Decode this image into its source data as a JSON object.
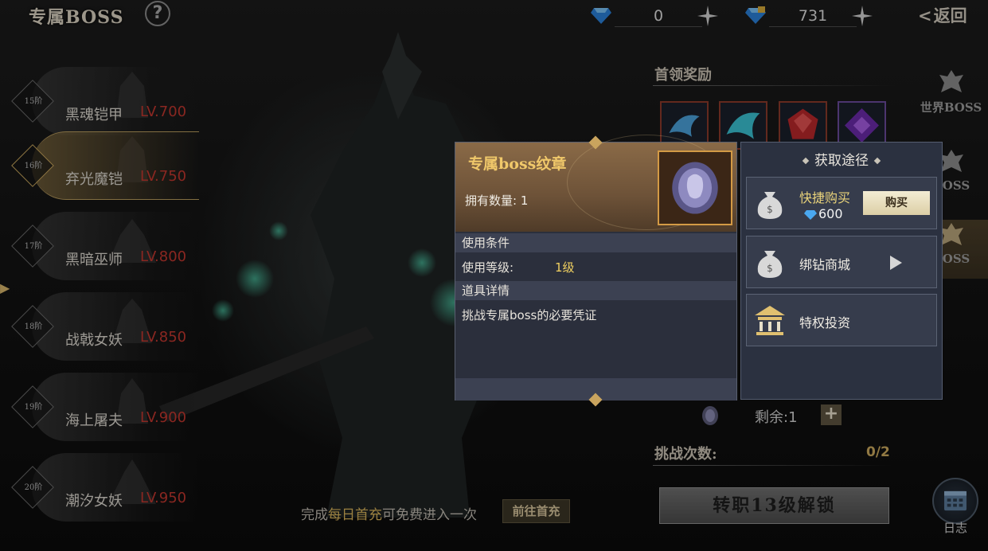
{
  "header": {
    "title": "专属BOSS",
    "help_label": "?",
    "currency": [
      {
        "icon": "diamond-icon",
        "value": "0"
      },
      {
        "icon": "bound-diamond-icon",
        "value": "731"
      }
    ],
    "back_label": "返回"
  },
  "boss_list": [
    {
      "tier": "15阶",
      "name": "黑魂铠甲",
      "level": "LV.700"
    },
    {
      "tier": "16阶",
      "name": "弃光魔铠",
      "level": "LV.750"
    },
    {
      "tier": "17阶",
      "name": "黑暗巫师",
      "level": "LV.800"
    },
    {
      "tier": "18阶",
      "name": "战戟女妖",
      "level": "LV.850"
    },
    {
      "tier": "19阶",
      "name": "海上屠夫",
      "level": "LV.900"
    },
    {
      "tier": "20阶",
      "name": "潮汐女妖",
      "level": "LV.950"
    }
  ],
  "rewards": {
    "title": "首领奖励",
    "items": [
      "blue-wing-icon",
      "cyan-wing-icon",
      "red-gem-icon",
      "purple-gem-icon"
    ]
  },
  "tabs": [
    {
      "label": "世界BOSS",
      "icon": "world-boss-icon"
    },
    {
      "label": "BOSS",
      "icon": "boss-icon"
    },
    {
      "label": "BOSS",
      "icon": "exclusive-boss-icon"
    }
  ],
  "remain": {
    "label": "剩余:1",
    "plus": "+"
  },
  "challenge": {
    "label": "挑战次数:",
    "value": "0/2"
  },
  "unlock_button": "转职13级解锁",
  "bottom_tip": {
    "prefix": "完成",
    "highlight": "每日首充",
    "suffix": "可免费进入一次",
    "button": "前往首充"
  },
  "log_label": "日志",
  "item_popup": {
    "title": "专属boss纹章",
    "owned": "拥有数量:  1",
    "section_use": "使用条件",
    "use_level_label": "使用等级:",
    "use_level_value": "1级",
    "section_detail": "道具详情",
    "detail": "挑战专属boss的必要凭证"
  },
  "acquire_panel": {
    "title": "获取途径",
    "quick_buy": {
      "label": "快捷购买",
      "price": "600",
      "button": "购买"
    },
    "bound_shop": {
      "label": "绑钻商城"
    },
    "privilege": {
      "label": "特权投资"
    }
  },
  "colors": {
    "gold": "#f0c86a",
    "level_red": "#c0362e",
    "highlight": "#d7b35a"
  }
}
